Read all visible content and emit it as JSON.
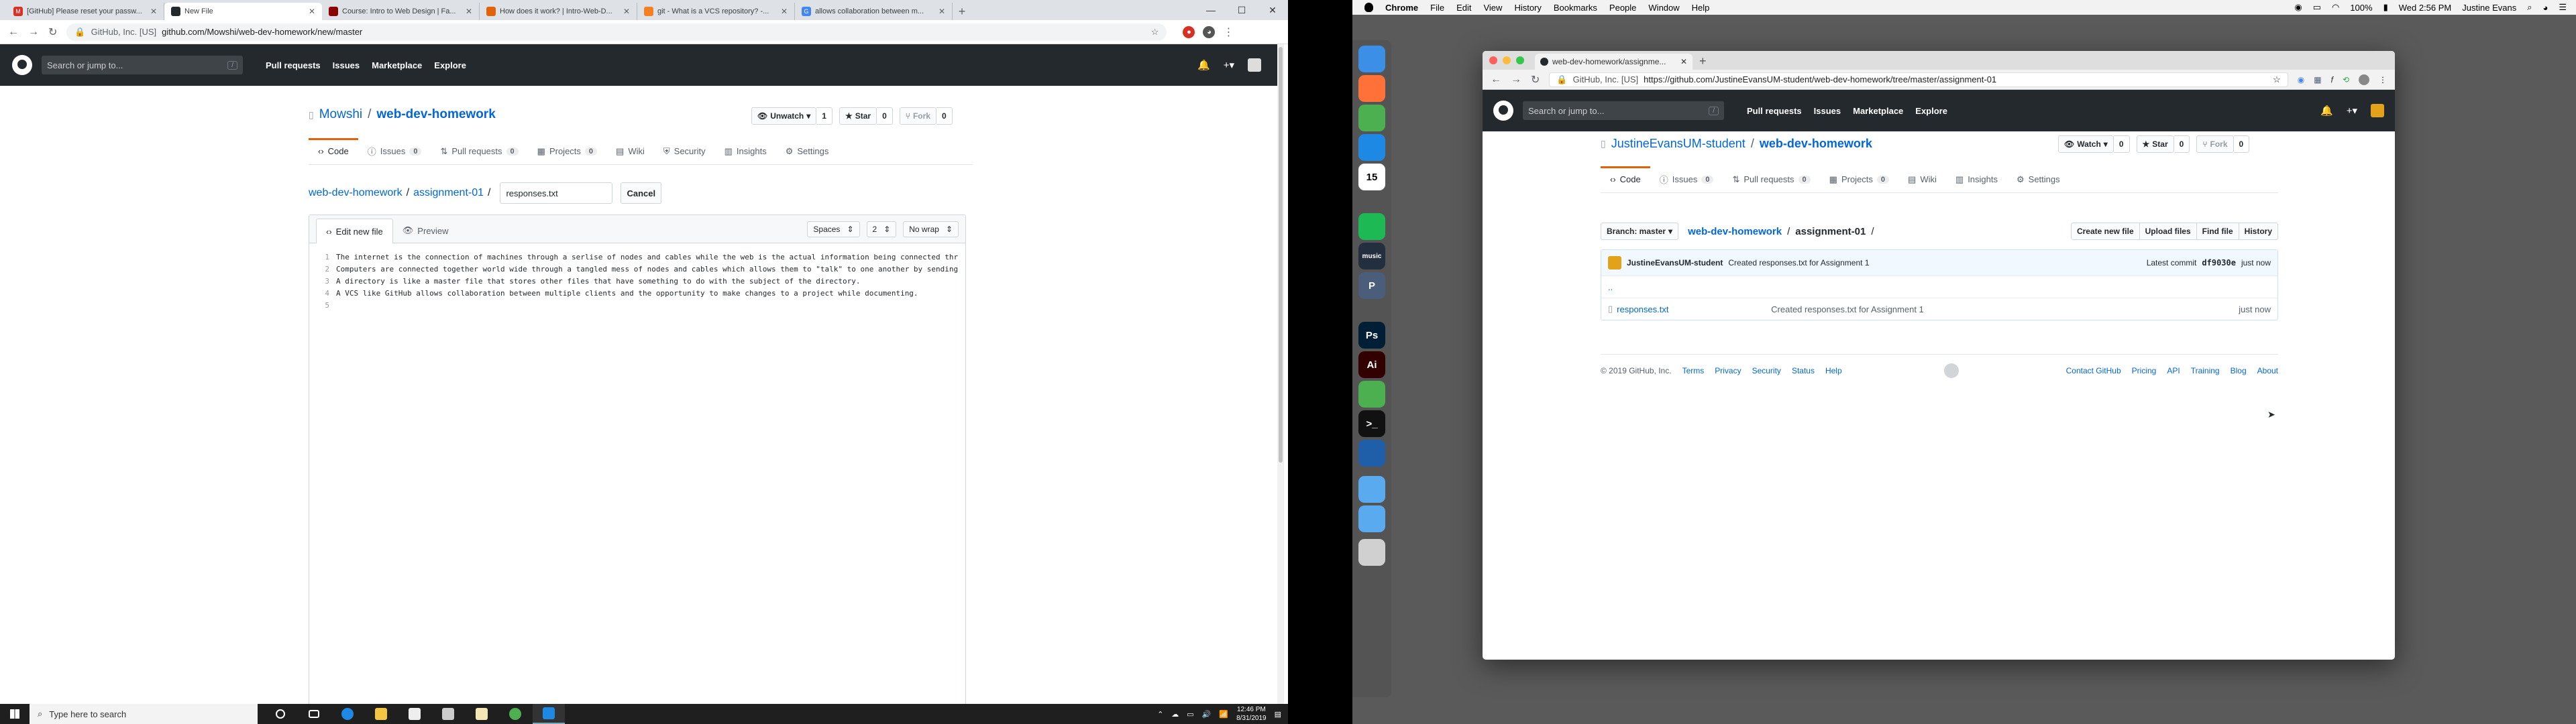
{
  "left": {
    "tabs": [
      {
        "label": "[GitHub] Please reset your passw...",
        "fav": "M",
        "color": "#d93025"
      },
      {
        "label": "New File",
        "fav": "",
        "color": "#24292e",
        "active": true
      },
      {
        "label": "Course: Intro to Web Design | Fa...",
        "fav": "",
        "color": "#8b0000"
      },
      {
        "label": "How does it work? | Intro-Web-D...",
        "fav": "",
        "color": "#e36209"
      },
      {
        "label": "git - What is a VCS repository? -...",
        "fav": "",
        "color": "#f48024"
      },
      {
        "label": "allows collaboration between m...",
        "fav": "G",
        "color": "#4285f4"
      }
    ],
    "url_prefix": "GitHub, Inc. [US]",
    "url": "github.com/Mowshi/web-dev-homework/new/master",
    "gh": {
      "search_placeholder": "Search or jump to...",
      "nav": [
        "Pull requests",
        "Issues",
        "Marketplace",
        "Explore"
      ]
    },
    "repo": {
      "owner": "Mowshi",
      "name": "web-dev-homework"
    },
    "repo_actions": {
      "watch": "Unwatch",
      "watch_count": "1",
      "star": "Star",
      "star_count": "0",
      "fork": "Fork",
      "fork_count": "0"
    },
    "repo_nav": [
      {
        "label": "Code",
        "count": ""
      },
      {
        "label": "Issues",
        "count": "0"
      },
      {
        "label": "Pull requests",
        "count": "0"
      },
      {
        "label": "Projects",
        "count": "0"
      },
      {
        "label": "Wiki",
        "count": ""
      },
      {
        "label": "Security",
        "count": ""
      },
      {
        "label": "Insights",
        "count": ""
      },
      {
        "label": "Settings",
        "count": ""
      }
    ],
    "editpath": {
      "repo": "web-dev-homework",
      "folder": "assignment-01",
      "filename": "responses.txt",
      "cancel": "Cancel"
    },
    "editor": {
      "tab_edit": "Edit new file",
      "tab_preview": "Preview",
      "indent_mode": "Spaces",
      "indent_size": "2",
      "wrap": "No wrap",
      "lines": [
        "The internet is the connection of machines through a serlise of nodes and cables while the web is the actual information being connected thr",
        "Computers are connected together world wide through a tangled mess of nodes and cables which allows them to \"talk\" to one another by sending",
        "A directory is like a master file that stores other files that have something to do with the subject of the directory.",
        "A VCS like GitHub allows collaboration between multiple clients and the opportunity to make changes to a project while documenting.",
        ""
      ]
    },
    "taskbar": {
      "search": "Type here to search",
      "time": "12:46 PM",
      "date": "8/31/2019"
    }
  },
  "right": {
    "menubar": {
      "app": "Chrome",
      "items": [
        "File",
        "Edit",
        "View",
        "History",
        "Bookmarks",
        "People",
        "Window",
        "Help"
      ],
      "battery": "100%",
      "clock": "Wed 2:56 PM",
      "user": "Justine Evans"
    },
    "tab": "web-dev-homework/assignme...",
    "url_prefix": "GitHub, Inc. [US]",
    "url": "https://github.com/JustineEvansUM-student/web-dev-homework/tree/master/assignment-01",
    "gh": {
      "search_placeholder": "Search or jump to...",
      "nav": [
        "Pull requests",
        "Issues",
        "Marketplace",
        "Explore"
      ]
    },
    "repo": {
      "owner": "JustineEvansUM-student",
      "name": "web-dev-homework"
    },
    "repo_actions": {
      "watch": "Watch",
      "watch_count": "0",
      "star": "Star",
      "star_count": "0",
      "fork": "Fork",
      "fork_count": "0"
    },
    "repo_nav": [
      {
        "label": "Code",
        "count": ""
      },
      {
        "label": "Issues",
        "count": "0"
      },
      {
        "label": "Pull requests",
        "count": "0"
      },
      {
        "label": "Projects",
        "count": "0"
      },
      {
        "label": "Wiki",
        "count": ""
      },
      {
        "label": "Insights",
        "count": ""
      },
      {
        "label": "Settings",
        "count": ""
      }
    ],
    "branch": "Branch: master",
    "path": {
      "repo": "web-dev-homework",
      "folder": "assignment-01"
    },
    "file_actions": [
      "Create new file",
      "Upload files",
      "Find file",
      "History"
    ],
    "commit": {
      "author": "JustineEvansUM-student",
      "message": "Created responses.txt for Assignment 1",
      "latest": "Latest commit",
      "sha": "df9030e",
      "time": "just now"
    },
    "files": [
      {
        "name": "..",
        "message": "",
        "time": ""
      },
      {
        "name": "responses.txt",
        "message": "Created responses.txt for Assignment 1",
        "time": "just now"
      }
    ],
    "footer_left": [
      "© 2019 GitHub, Inc.",
      "Terms",
      "Privacy",
      "Security",
      "Status",
      "Help"
    ],
    "footer_right": [
      "Contact GitHub",
      "Pricing",
      "API",
      "Training",
      "Blog",
      "About"
    ],
    "dock": [
      {
        "name": "finder-icon",
        "color": "#3b8fe6",
        "glyph": ""
      },
      {
        "name": "firefox-icon",
        "color": "#ff7139",
        "glyph": ""
      },
      {
        "name": "chrome-icon",
        "color": "#4caf50",
        "glyph": ""
      },
      {
        "name": "safari-icon",
        "color": "#1e88e5",
        "glyph": ""
      },
      {
        "name": "calendar-icon",
        "color": "#ffffff",
        "glyph": "15"
      },
      {
        "name": "spotify-icon",
        "color": "#1db954",
        "glyph": ""
      },
      {
        "name": "amazon-music-icon",
        "color": "#232f3e",
        "glyph": "music"
      },
      {
        "name": "pages-icon",
        "color": "#4a5d7a",
        "glyph": "P"
      },
      {
        "name": "photoshop-icon",
        "color": "#001e36",
        "glyph": "Ps"
      },
      {
        "name": "illustrator-icon",
        "color": "#330000",
        "glyph": "Ai"
      },
      {
        "name": "globe-icon",
        "color": "#4caf50",
        "glyph": ""
      },
      {
        "name": "terminal-icon",
        "color": "#111111",
        "glyph": ">_"
      },
      {
        "name": "quicktime-icon",
        "color": "#1f5ea8",
        "glyph": ""
      },
      {
        "name": "folder-icon",
        "color": "#5aaaf0",
        "glyph": ""
      },
      {
        "name": "downloads-folder-icon",
        "color": "#5aaaf0",
        "glyph": ""
      },
      {
        "name": "trash-icon",
        "color": "#d0d0d0",
        "glyph": ""
      }
    ]
  }
}
